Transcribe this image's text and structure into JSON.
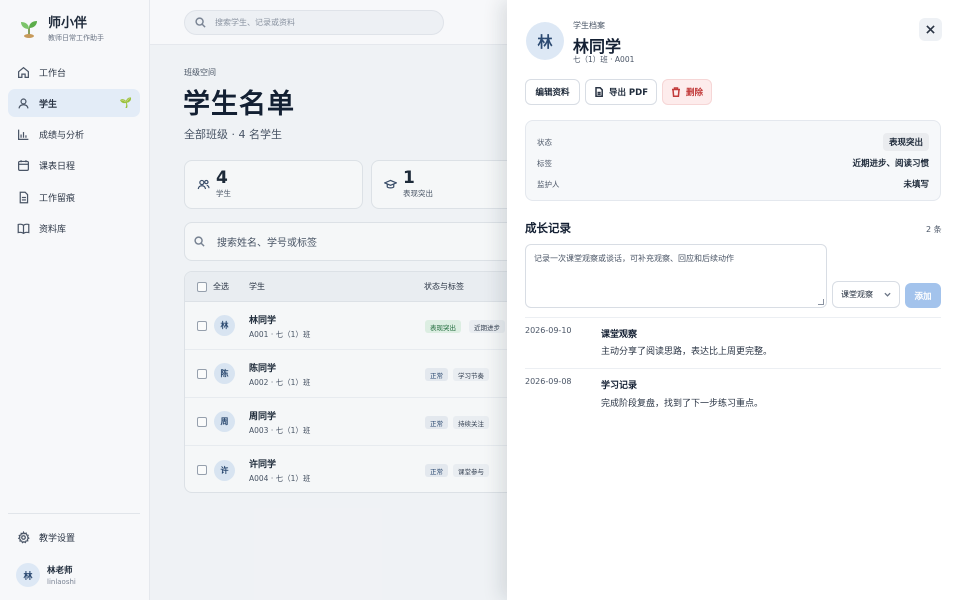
{
  "brand": {
    "name": "师小伴",
    "tagline": "教师日常工作助手"
  },
  "global_search": {
    "placeholder": "搜索学生、记录或资料"
  },
  "nav": [
    {
      "label": "工作台",
      "icon": "home-icon"
    },
    {
      "label": "学生",
      "icon": "user-icon",
      "active": true
    },
    {
      "label": "成绩与分析",
      "icon": "bar-chart-icon"
    },
    {
      "label": "课表日程",
      "icon": "calendar-icon"
    },
    {
      "label": "工作留痕",
      "icon": "document-icon"
    },
    {
      "label": "资料库",
      "icon": "book-icon"
    }
  ],
  "settings_label": "教学设置",
  "user": {
    "avatar": "林",
    "name": "林老师",
    "id": "linlaoshi"
  },
  "page": {
    "eyebrow": "班级空间",
    "title": "学生名单",
    "subtitle": "全部班级 · 4 名学生"
  },
  "stats": [
    {
      "value": "4",
      "label": "学生",
      "icon": "users-icon"
    },
    {
      "value": "1",
      "label": "表现突出",
      "icon": "graduation-cap-icon"
    }
  ],
  "list_search": {
    "placeholder": "搜索姓名、学号或标签"
  },
  "table": {
    "headers": {
      "select_all": "全选",
      "student": "学生",
      "status": "状态与标签"
    },
    "rows": [
      {
        "avatar": "林",
        "name": "林同学",
        "meta": "A001 · 七（1）班",
        "status": "表现突出",
        "status_type": "good",
        "tag": "近期进步"
      },
      {
        "avatar": "陈",
        "name": "陈同学",
        "meta": "A002 · 七（1）班",
        "status": "正常",
        "status_type": "normal",
        "tag": "学习节奏"
      },
      {
        "avatar": "周",
        "name": "周同学",
        "meta": "A003 · 七（1）班",
        "status": "正常",
        "status_type": "normal",
        "tag": "持续关注"
      },
      {
        "avatar": "许",
        "name": "许同学",
        "meta": "A004 · 七（1）班",
        "status": "正常",
        "status_type": "normal",
        "tag": "课堂参与"
      }
    ]
  },
  "drawer": {
    "avatar": "林",
    "eyebrow": "学生档案",
    "name": "林同学",
    "meta": "七（1）班 · A001",
    "actions": {
      "edit": "编辑资料",
      "export": "导出 PDF",
      "delete": "删除"
    },
    "info": [
      {
        "key": "状态",
        "value": "表现突出"
      },
      {
        "key": "标签",
        "value": "近期进步、阅读习惯"
      },
      {
        "key": "监护人",
        "value": "未填写"
      }
    ],
    "records_title": "成长记录",
    "records_count": "2 条",
    "textarea_placeholder": "记录一次课堂观察或谈话，可补充观察、回应和后续动作",
    "record_type_selected": "课堂观察",
    "add_label": "添加",
    "records": [
      {
        "date": "2026-09-10",
        "type": "课堂观察",
        "text": "主动分享了阅读思路，表达比上周更完整。"
      },
      {
        "date": "2026-09-08",
        "type": "学习记录",
        "text": "完成阶段复盘，找到了下一步练习重点。"
      }
    ]
  },
  "colors": {
    "accent": "#2c4a72",
    "active_nav": "#e3ecf7",
    "good": "#1f6b3a",
    "danger": "#c23a3a",
    "add_button": "#a3c3ec"
  }
}
